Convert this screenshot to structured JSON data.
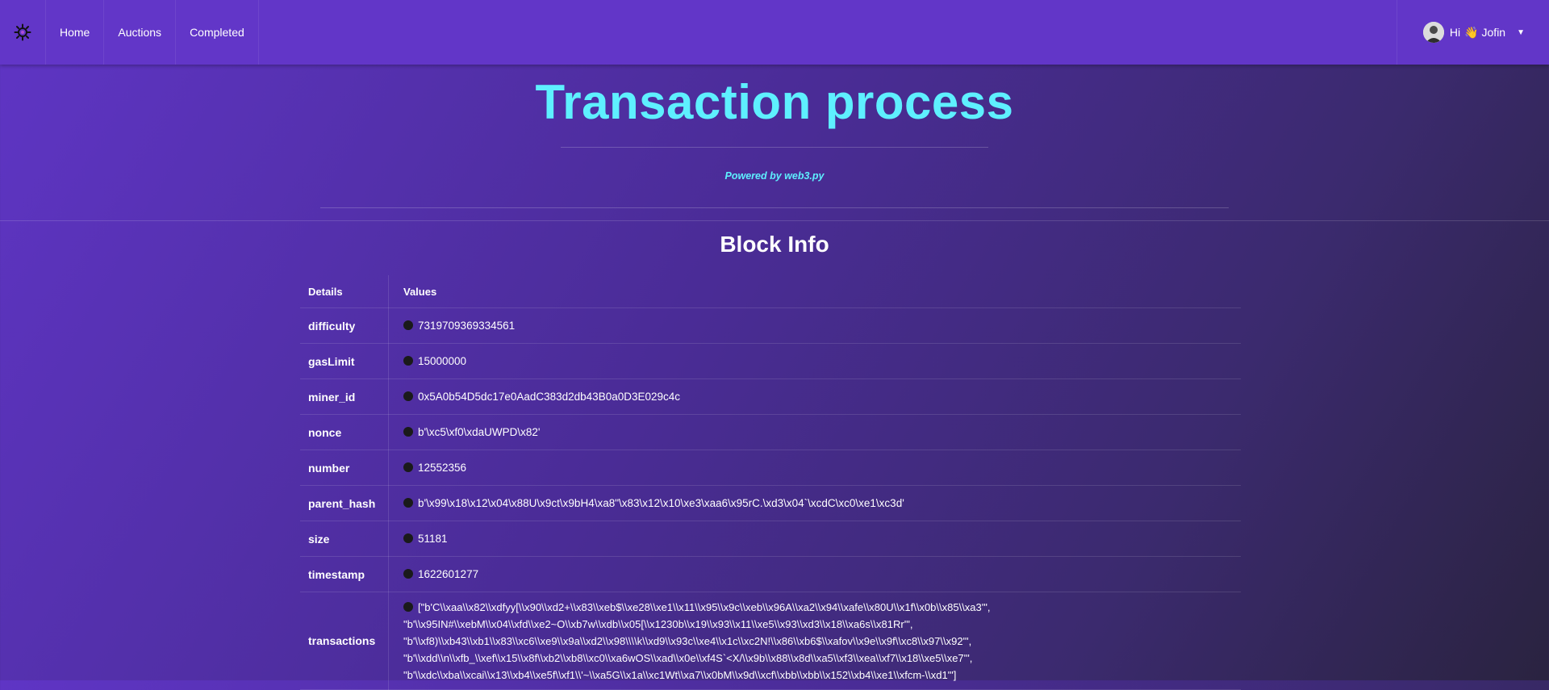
{
  "nav": {
    "brand_icon": "gear-bug-icon",
    "items": [
      {
        "label": "Home"
      },
      {
        "label": "Auctions"
      },
      {
        "label": "Completed"
      }
    ],
    "user": {
      "greeting": "Hi",
      "wave": "👋",
      "name": "Jofin"
    }
  },
  "header": {
    "title": "Transaction process",
    "powered": "Powered by web3.py"
  },
  "block_info": {
    "title": "Block Info",
    "col_details": "Details",
    "col_values": "Values",
    "rows": [
      {
        "key": "difficulty",
        "value": "7319709369334561"
      },
      {
        "key": "gasLimit",
        "value": "15000000"
      },
      {
        "key": "miner_id",
        "value": "0x5A0b54D5dc17e0AadC383d2db43B0a0D3E029c4c"
      },
      {
        "key": "nonce",
        "value": "b'\\xc5\\xf0\\xdaUWPD\\x82'"
      },
      {
        "key": "number",
        "value": "12552356"
      },
      {
        "key": "parent_hash",
        "value": "b'\\x99\\x18\\x12\\x04\\x88U\\x9ct\\x9bH4\\xa8\"\\x83\\x12\\x10\\xe3\\xaa6\\x95rC.\\xd3\\x04`\\xcdC\\xc0\\xe1\\xc3d'"
      },
      {
        "key": "size",
        "value": "51181"
      },
      {
        "key": "timestamp",
        "value": "1622601277"
      }
    ],
    "transactions": {
      "key": "transactions",
      "lines": [
        "[\"b'C\\\\xaa\\\\x82\\\\xdfyy[\\\\x90\\\\xd2+\\\\x83\\\\xeb$\\\\xe28\\\\xe1\\\\x11\\\\x95\\\\x9c\\\\xeb\\\\x96A\\\\xa2\\\\x94\\\\xafe\\\\x80U\\\\x1f\\\\x0b\\\\x85\\\\xa3'\",",
        "\"b'\\\\x95IN#\\\\xebM\\\\x04\\\\xfd\\\\xe2~O\\\\xb7w\\\\xdb\\\\x05[\\\\x1230b\\\\x19\\\\x93\\\\x11\\\\xe5\\\\x93\\\\xd3\\\\x18\\\\xa6s\\\\x81Rr'\",",
        "\"b'\\\\xf8)\\\\xb43\\\\xb1\\\\x83\\\\xc6\\\\xe9\\\\x9a\\\\xd2\\\\x98\\\\\\\\k\\\\xd9\\\\x93c\\\\xe4\\\\x1c\\\\xc2N!\\\\x86\\\\xb6$\\\\xafov\\\\x9e\\\\x9f\\\\xc8\\\\x97\\\\x92'\",",
        "\"b'\\\\xdd\\\\n\\\\xfb_\\\\xef\\\\x15\\\\x8f\\\\xb2\\\\xb8\\\\xc0\\\\xa6wOS\\\\xad\\\\x0e\\\\xf4S`<X/\\\\x9b\\\\x88\\\\x8d\\\\xa5\\\\xf3\\\\xea\\\\xf7\\\\x18\\\\xe5\\\\xe7'\",",
        "\"b'\\\\xdc\\\\xba\\\\xcai\\\\x13\\\\xb4\\\\xe5f\\\\xf1\\\\'~\\\\xa5G\\\\x1a\\\\xc1Wt\\\\xa7\\\\x0bM\\\\x9d\\\\xcf\\\\xbb\\\\xbb\\\\x152\\\\xb4\\\\xe1\\\\xfcm-\\\\xd1'\"]"
      ]
    }
  },
  "colors": {
    "nav_bg": "#6236c8",
    "accent": "#5ef0ff",
    "dot": "#1a1a1a"
  }
}
